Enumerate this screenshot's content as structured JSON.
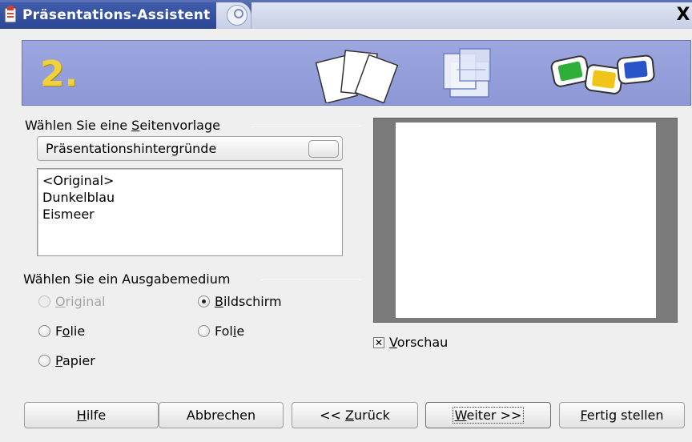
{
  "window": {
    "title": "Präsentations-Assistent",
    "close_glyph": "X"
  },
  "banner": {
    "step": "2."
  },
  "page_template": {
    "heading_prefix": "Wählen Sie eine ",
    "heading_mnemonic": "S",
    "heading_suffix": "eitenvorlage",
    "category_value": "Präsentationshintergründe",
    "items": [
      "<Original>",
      "Dunkelblau",
      "Eismeer"
    ]
  },
  "output_medium": {
    "heading": "Wählen Sie ein Ausgabemedium",
    "options": [
      {
        "pre": "",
        "mn": "O",
        "post": "riginal",
        "checked": false,
        "disabled": true
      },
      {
        "pre": "",
        "mn": "B",
        "post": "ildschirm",
        "checked": true,
        "disabled": false
      },
      {
        "pre": "F",
        "mn": "o",
        "post": "lie",
        "checked": false,
        "disabled": false
      },
      {
        "pre": "Fol",
        "mn": "i",
        "post": "e",
        "checked": false,
        "disabled": false
      },
      {
        "pre": "",
        "mn": "P",
        "post": "apier",
        "checked": false,
        "disabled": false
      }
    ]
  },
  "preview": {
    "checkbox_pre": "",
    "checkbox_mn": "V",
    "checkbox_post": "orschau",
    "checked": true,
    "check_glyph": "✕"
  },
  "buttons": {
    "help": {
      "pre": "",
      "mn": "H",
      "post": "ilfe"
    },
    "cancel": "Abbrechen",
    "back": {
      "pre": "<< ",
      "mn": "Z",
      "post": "urück"
    },
    "next": {
      "pre": "",
      "mn": "W",
      "post": "eiter >>"
    },
    "finish": {
      "pre": "",
      "mn": "F",
      "post": "ertig stellen"
    }
  },
  "colors": {
    "banner": "#949fdb",
    "step_number": "#f2d23a",
    "titlebar": "#3e5aa6"
  },
  "icons": {
    "app": "impress-document-icon",
    "sticky": "sticky-pin-icon",
    "close": "close-icon"
  }
}
